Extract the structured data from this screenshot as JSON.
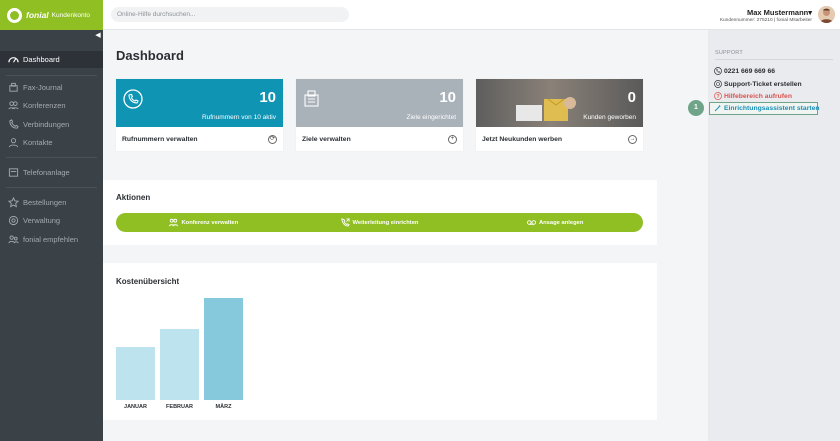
{
  "brand": {
    "name": "fonial",
    "product": "Kundenkonto"
  },
  "sidebar": {
    "items": [
      {
        "label": "Dashboard",
        "icon": "dashboard-icon"
      },
      {
        "label": "Fax-Journal",
        "icon": "fax-icon"
      },
      {
        "label": "Konferenzen",
        "icon": "conference-icon"
      },
      {
        "label": "Verbindungen",
        "icon": "connections-icon"
      },
      {
        "label": "Kontakte",
        "icon": "contacts-icon"
      },
      {
        "label": "Telefonanlage",
        "icon": "phone-system-icon"
      },
      {
        "label": "Bestellungen",
        "icon": "orders-icon"
      },
      {
        "label": "Verwaltung",
        "icon": "admin-icon"
      },
      {
        "label": "fonial empfehlen",
        "icon": "recommend-icon"
      }
    ]
  },
  "header": {
    "search_placeholder": "Online-Hilfe durchsuchen...",
    "user_name": "Max Mustermann",
    "user_caret": "▾",
    "user_sub": "Kundennummer: 275210 | fonial Mitarbeiter"
  },
  "main": {
    "title": "Dashboard",
    "tiles": [
      {
        "number": "10",
        "caption": "Rufnummern von 10 aktiv",
        "footer": "Rufnummern verwalten",
        "color": "#0f94b4",
        "icon": "phone-icon",
        "action": "⟳"
      },
      {
        "number": "10",
        "caption": "Ziele eingerichtet",
        "footer": "Ziele verwalten",
        "color": "#a9b1b9",
        "icon": "fax-device-icon",
        "action": "+"
      },
      {
        "number": "0",
        "caption": "Kunden geworben",
        "footer": "Jetzt Neukunden werben",
        "color": "#6a6a6a",
        "icon": "gift-photo",
        "action": "→"
      }
    ],
    "actions_title": "Aktionen",
    "actions": [
      {
        "label": "Konferenz verwalten",
        "icon": "conference-icon"
      },
      {
        "label": "Weiterleitung einrichten",
        "icon": "forward-icon"
      },
      {
        "label": "Ansage anlegen",
        "icon": "voicemail-icon"
      }
    ],
    "costs_title": "Kostenübersicht"
  },
  "chart_data": {
    "type": "bar",
    "categories": [
      "JANUAR",
      "FEBRUAR",
      "MÄRZ"
    ],
    "values": [
      59,
      79,
      113
    ],
    "ylim": [
      0,
      120
    ],
    "grid": false,
    "colors": [
      "#bde3ee",
      "#bde3ee",
      "#86c9dc"
    ]
  },
  "support": {
    "title": "SUPPORT",
    "items": [
      {
        "label": "0221 669 669 66",
        "color": "#2b2f33",
        "icon": "phone-icon"
      },
      {
        "label": "Support-Ticket erstellen",
        "color": "#2b2f33",
        "icon": "ticket-icon"
      },
      {
        "label": "Hilfebereich aufrufen",
        "color": "#d9534f",
        "icon": "help-icon"
      },
      {
        "label": "Einrichtungsassistent starten",
        "color": "#1a8fb5",
        "icon": "wizard-icon"
      }
    ],
    "step_badge": "1"
  }
}
